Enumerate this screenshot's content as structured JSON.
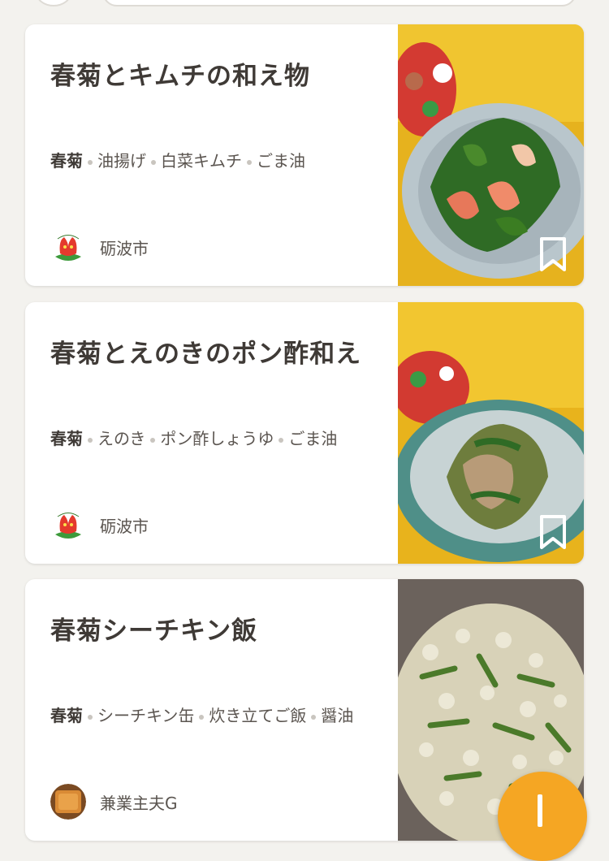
{
  "recipes": [
    {
      "title": "春菊とキムチの和え物",
      "ingredients": [
        "春菊",
        "油揚げ",
        "白菜キムチ",
        "ごま油"
      ],
      "author": "砺波市",
      "author_avatar_icon": "tonami-city-tulip-logo",
      "photo_desc_icon": "kimchi-salad-plate"
    },
    {
      "title": "春菊とえのきのポン酢和え",
      "ingredients": [
        "春菊",
        "えのき",
        "ポン酢しょうゆ",
        "ごま油"
      ],
      "author": "砺波市",
      "author_avatar_icon": "tonami-city-tulip-logo",
      "photo_desc_icon": "enoki-salad-bowl"
    },
    {
      "title": "春菊シーチキン飯",
      "ingredients": [
        "春菊",
        "シーチキン缶",
        "炊き立てご飯",
        "醤油"
      ],
      "author": "兼業主夫G",
      "author_avatar_icon": "user-photo-avatar",
      "photo_desc_icon": "mixed-rice-bowl"
    }
  ],
  "colors": {
    "accent": "#f5a623",
    "background": "#f3f2ee",
    "title_text": "#3f3a36",
    "body_text": "#5b5550"
  }
}
